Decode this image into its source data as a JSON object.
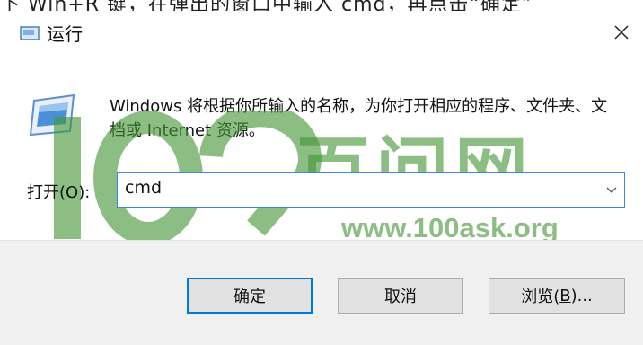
{
  "top_caption": "下 Win+R 键，在弹出的窗口中输入 cmd，再点击“确定”",
  "window": {
    "title": "运行",
    "close_label": "✕"
  },
  "description": "Windows 将根据你所输入的名称，为你打开相应的程序、文件夹、文档或 Internet 资源。",
  "open_label_prefix": "打开(",
  "open_label_key": "O",
  "open_label_suffix": "):",
  "command_input": {
    "value": "cmd"
  },
  "buttons": {
    "ok": "确定",
    "cancel": "取消",
    "browse_prefix": "浏览(",
    "browse_key": "B",
    "browse_suffix": ")..."
  },
  "watermark": {
    "text": "百问网",
    "url": "www.100ask.org",
    "digits": "100"
  },
  "colors": {
    "accent": "#0078d7",
    "input_border": "#3a86e0",
    "footer_bg": "#f0f0f0",
    "watermark": "#469637"
  }
}
